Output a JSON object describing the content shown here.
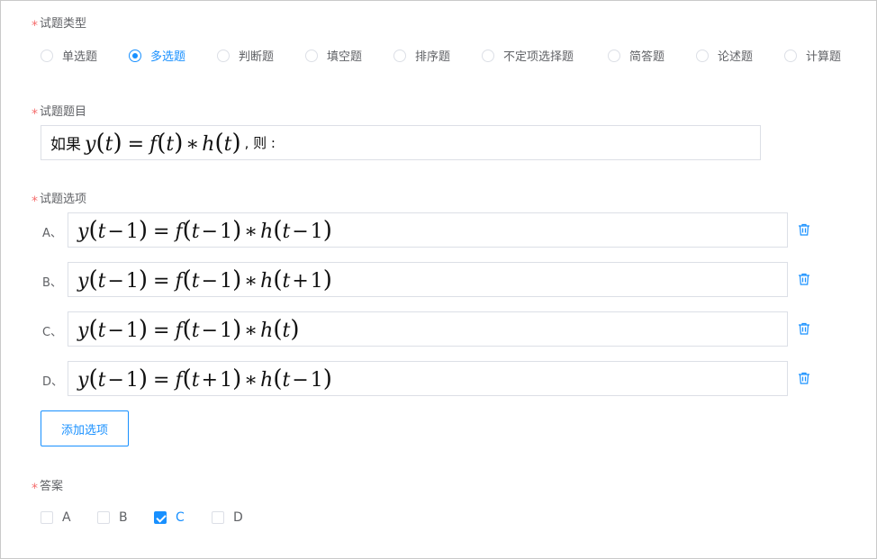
{
  "required_mark": "*",
  "question_type": {
    "label": "试题类型",
    "options": [
      "单选题",
      "多选题",
      "判断题",
      "填空题",
      "排序题",
      "不定项选择题",
      "简答题",
      "论述题",
      "计算题"
    ],
    "selected": "多选题"
  },
  "question_stem": {
    "label": "试题题目",
    "prefix": "如果",
    "suffix": ", 则 :"
  },
  "options_section": {
    "label": "试题选项",
    "items": [
      {
        "letter": "A、"
      },
      {
        "letter": "B、"
      },
      {
        "letter": "C、"
      },
      {
        "letter": "D、"
      }
    ],
    "add_button": "添加选项"
  },
  "answer": {
    "label": "答案",
    "choices": [
      "A",
      "B",
      "C",
      "D"
    ],
    "checked": [
      "C"
    ]
  },
  "colors": {
    "accent": "#1890ff",
    "required": "#f56c6c",
    "border": "#dcdfe6"
  },
  "icons": {
    "delete": "trash-icon"
  }
}
